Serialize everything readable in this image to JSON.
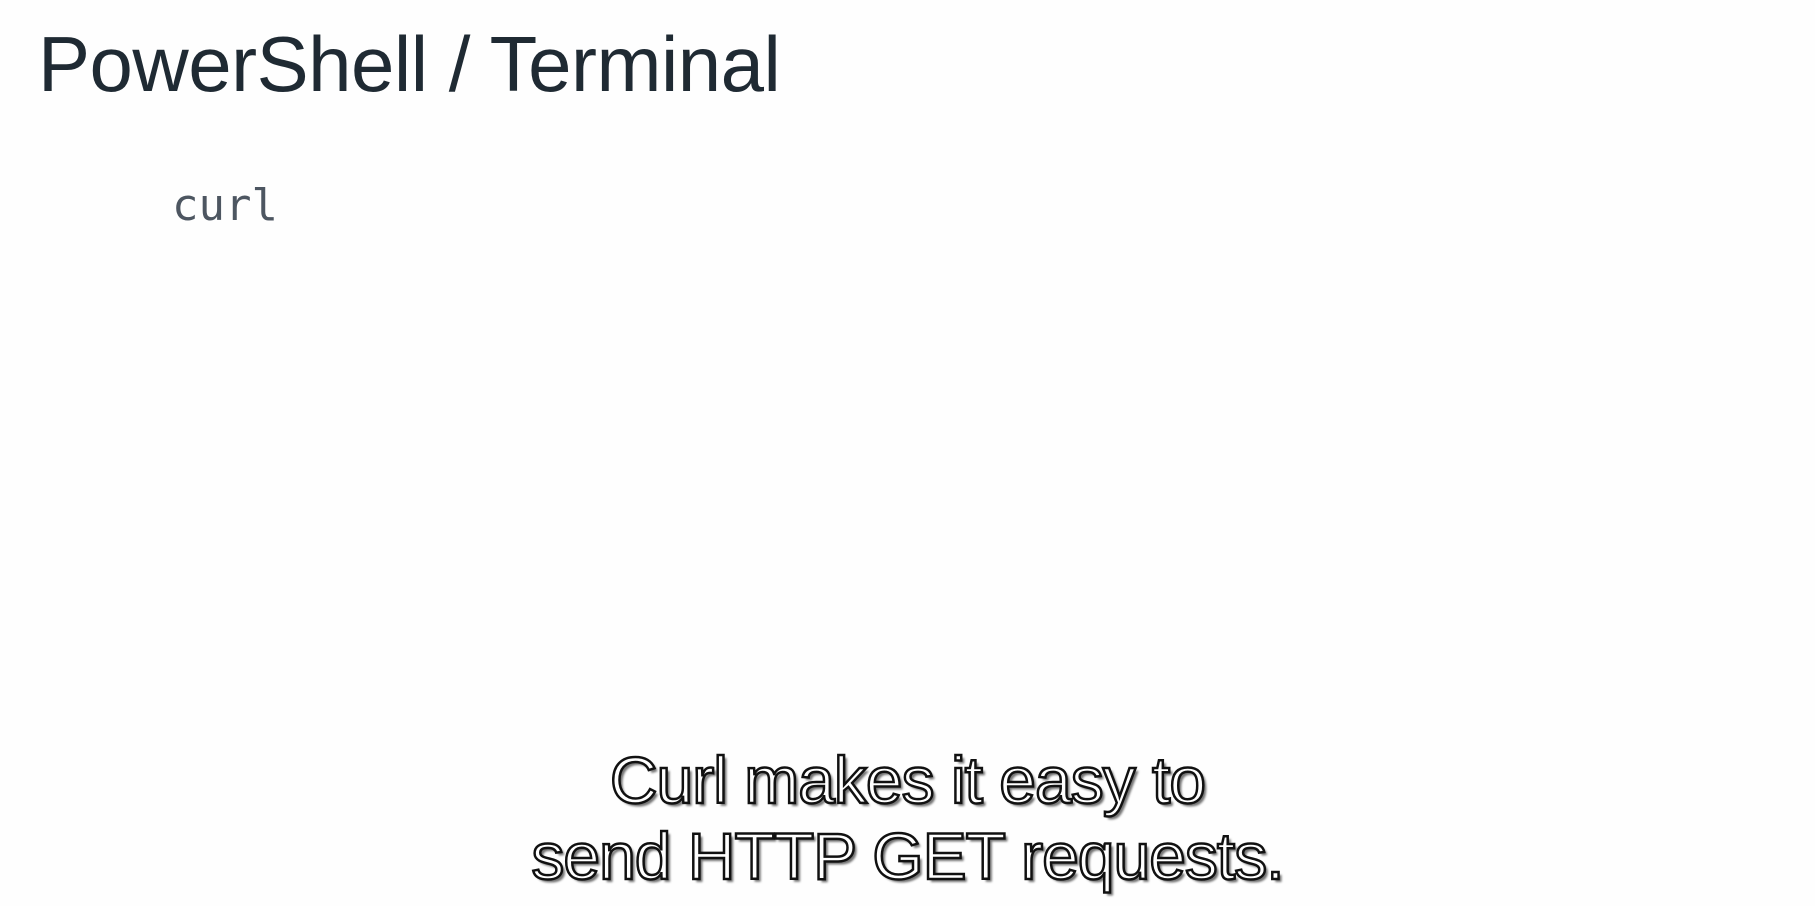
{
  "slide": {
    "title": "PowerShell / Terminal",
    "code": "curl"
  },
  "subtitles": {
    "line1": "Curl makes it easy to",
    "line2": "send HTTP GET requests."
  },
  "colors": {
    "background": "#fefefe",
    "title": "#1f2a33",
    "code": "#4d5661",
    "subtitle_fill": "#ffffff",
    "subtitle_outline": "#111111"
  }
}
